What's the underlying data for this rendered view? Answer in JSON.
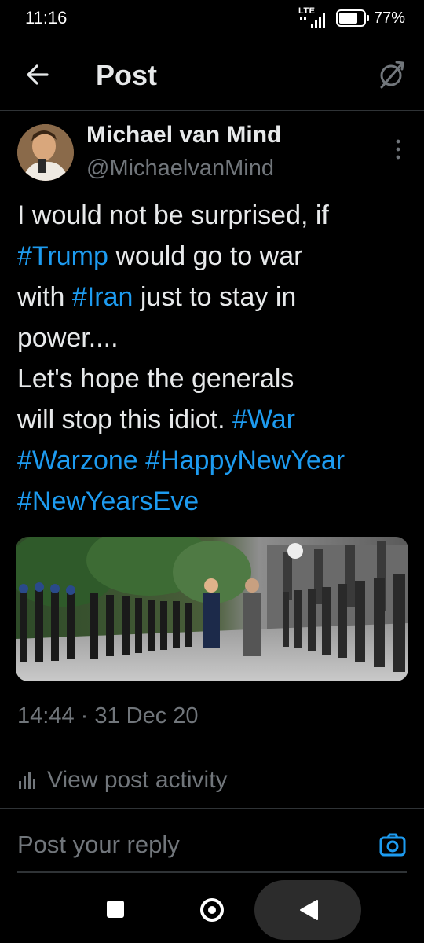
{
  "status_bar": {
    "time": "11:16",
    "network": "LTE",
    "battery_percent": "77%",
    "battery_level": 0.77
  },
  "header": {
    "title": "Post",
    "back_icon": "arrow-left-icon",
    "refresh_icon": "refresh-icon"
  },
  "post": {
    "author_name": "Michael van Mind",
    "author_handle": "@MichaelvanMind",
    "text_lines": [
      [
        {
          "t": "I would not be surprised,  if",
          "tag": false
        }
      ],
      [
        {
          "t": "#Trump",
          "tag": true
        },
        {
          "t": " would go to war",
          "tag": false
        }
      ],
      [
        {
          "t": "with ",
          "tag": false
        },
        {
          "t": "#Iran",
          "tag": true
        },
        {
          "t": " just to stay in",
          "tag": false
        }
      ],
      [
        {
          "t": "power....",
          "tag": false
        }
      ],
      [
        {
          "t": "Let's hope the generals",
          "tag": false
        }
      ],
      [
        {
          "t": "will stop this idiot. ",
          "tag": false
        },
        {
          "t": "#War",
          "tag": true
        }
      ],
      [
        {
          "t": "#Warzone",
          "tag": true
        },
        {
          "t": " ",
          "tag": false
        },
        {
          "t": "#HappyNewYear",
          "tag": true
        }
      ],
      [
        {
          "t": "#NewYearsEve",
          "tag": true
        }
      ]
    ],
    "timestamp": "14:44 · 31 Dec 20",
    "activity_label": "View post activity"
  },
  "reply": {
    "placeholder": "Post your reply",
    "camera_icon": "camera-icon"
  },
  "colors": {
    "background": "#000000",
    "text": "#e7e9ea",
    "secondary": "#71767b",
    "hashtag": "#1d9bf0",
    "divider": "#2f3336"
  }
}
